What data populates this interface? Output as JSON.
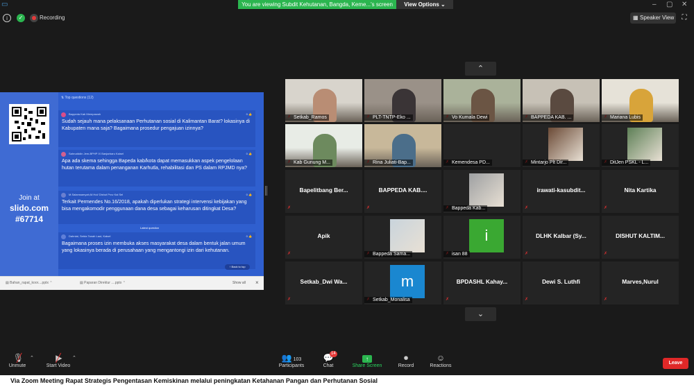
{
  "window": {
    "minimize": "–",
    "maximize": "▢",
    "close": "✕"
  },
  "share_banner": "You are viewing Subdit Kehutanan, Bangda, Keme...'s screen",
  "view_options": "View Options ⌄",
  "recording_label": "Recording",
  "speaker_view_label": "Speaker View",
  "slido": {
    "top_questions": "Top questions (12)",
    "join_line1": "Join at",
    "join_line2": "slido.com",
    "join_line3": "#67714",
    "latest_label": "Latest question",
    "back_to_top": "Back to top",
    "questions": [
      {
        "author": "Bappeda Kab Mempawah",
        "likes": "0",
        "avatar_color": "#d94d8a",
        "text": "Sudah sejauh mana pelaksanaan Perhutanan sosial di Kalimantan Barat? lokasinya di Kabupaten mana saja? Bagaimana prosedur pengajuan izinnya?"
      },
      {
        "author": "Sahrudddin Jem-BPHP IX Banjarbaru Kalsel",
        "likes": "0",
        "avatar_color": "#d06090",
        "text": "Apa ada skema sehingga Bapeda kab/kota dapat memasukkan aspek pengelolaan hutan terutama dalam penanganan Karhutla, rehabilitasi dan PS dalam RPJMD nya?"
      },
      {
        "author": "M.Salamsamyah,M.Hut/ Dishut Prov Kal Sel",
        "likes": "0",
        "avatar_color": "#6a7fd0",
        "text": "Terkait Permendes No.16/2018, apakah diperlukan strategi intervensi kebijakan yang bisa mengakomodir penggunaan dana desa sebagai keharusan ditingkat Desa?"
      },
      {
        "author": "Dahniat, Setda Tanah Laut, Kalsel",
        "likes": "0",
        "avatar_color": "#5f7fd8",
        "text": "Bagaimana proses izin membuka akses masyarakat desa dalam bentuk jalan umum yang lokasinya berada di perusahaan yang mengantongi izin dari kehutanan."
      }
    ],
    "downloads": [
      "Bahan_rapat_koor....pptx",
      "Paparan Direktur ....pptx"
    ],
    "show_all": "Show all"
  },
  "gallery": {
    "up_arrow": "⌃",
    "down_arrow": "⌄",
    "tiles": [
      {
        "name": "Setkab_Ramos",
        "kind": "video"
      },
      {
        "name": "PLT-TNTP-Eko ...",
        "kind": "video"
      },
      {
        "name": "Vo Kumala Dewi",
        "kind": "video"
      },
      {
        "name": "BAPPEDA KAB. ...",
        "kind": "video"
      },
      {
        "name": "Mariana Lubis",
        "kind": "video"
      },
      {
        "name": "Kab Gunung M...",
        "kind": "video"
      },
      {
        "name": "Rina Juliati-Bap...",
        "kind": "video"
      },
      {
        "name": "Kemendesa PD...",
        "kind": "blank"
      },
      {
        "name": "Mintarjo Plt Dir...",
        "kind": "photo"
      },
      {
        "name": "DitJen PSKL - L...",
        "kind": "photo"
      },
      {
        "name": "",
        "big": "Bapelitbang Ber...",
        "kind": "text"
      },
      {
        "name": "",
        "big": "BAPPEDA KAB....",
        "kind": "text"
      },
      {
        "name": "Bappeda Kab...",
        "kind": "photo"
      },
      {
        "name": "",
        "big": "irawati-kasubdit...",
        "kind": "text"
      },
      {
        "name": "",
        "big": "Nita Kartika",
        "kind": "text"
      },
      {
        "name": "",
        "big": "Apik",
        "kind": "text"
      },
      {
        "name": "Bappeda Sama...",
        "kind": "photo"
      },
      {
        "name": "isan 88",
        "kind": "letter",
        "letter": "i",
        "color": "#3aa832"
      },
      {
        "name": "",
        "big": "DLHK Kalbar (Sy...",
        "kind": "text"
      },
      {
        "name": "",
        "big": "DISHUT KALTIM...",
        "kind": "text"
      },
      {
        "name": "",
        "big": "Setkab_Dwi Wa...",
        "kind": "text"
      },
      {
        "name": "Setkab_Monalisa",
        "kind": "letter",
        "letter": "m",
        "color": "#1a87d0"
      },
      {
        "name": "",
        "big": "BPDASHL Kahay...",
        "kind": "text"
      },
      {
        "name": "",
        "big": "Dewi S. Luthfi",
        "kind": "text"
      },
      {
        "name": "",
        "big": "Marves,Nurul",
        "kind": "text"
      }
    ]
  },
  "toolbar": {
    "unmute": "Unmute",
    "start_video": "Start Video",
    "participants": "Participants",
    "participants_count": "103",
    "chat": "Chat",
    "chat_badge": "14",
    "share_screen": "Share Screen",
    "record": "Record",
    "reactions": "Reactions",
    "leave": "Leave"
  },
  "caption": "Via Zoom Meeting Rapat Strategis Pengentasan Kemiskinan melalui peningkatan Ketahanan Pangan  dan Perhutanan Sosial"
}
